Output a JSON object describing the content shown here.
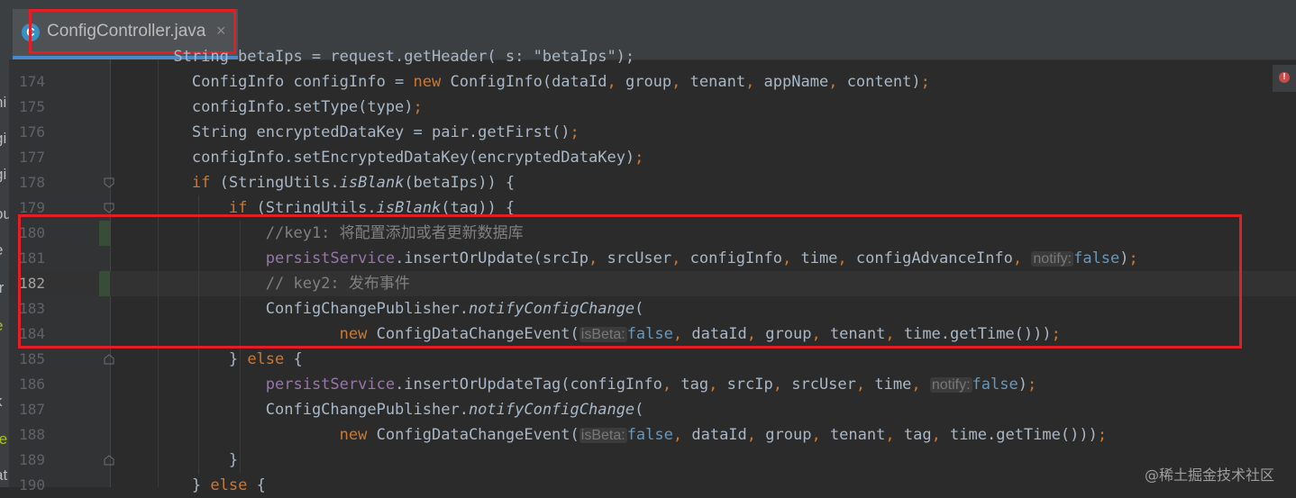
{
  "tab": {
    "title": "ConfigController.java",
    "icon": "C",
    "close": "×"
  },
  "left_fragments": [
    "hi",
    "gi",
    "gi",
    "ou",
    "e",
    "[r",
    "e",
    "[",
    "k",
    "te",
    "at"
  ],
  "line_numbers": [
    "174",
    "175",
    "176",
    "177",
    "178",
    "179",
    "180",
    "181",
    "182",
    "183",
    "184",
    "185",
    "186",
    "187",
    "188",
    "189",
    "190"
  ],
  "code": {
    "top_partial": "String betaIps = request.getHeader( s: \"betaIps\");",
    "l174": {
      "t1": "ConfigInfo configInfo = ",
      "kw": "new",
      "t2": " ConfigInfo(dataId",
      "c1": ",",
      "t3": " group",
      "c2": ",",
      "t4": " tenant",
      "c3": ",",
      "t5": " appName",
      "c4": ",",
      "t6": " content)",
      "semi": ";"
    },
    "l175": {
      "t1": "configInfo.setType(type)",
      "semi": ";"
    },
    "l176": {
      "t1": "String encryptedDataKey = pair.getFirst()",
      "semi": ";"
    },
    "l177": {
      "t1": "configInfo.setEncryptedDataKey(encryptedDataKey)",
      "semi": ";"
    },
    "l178": {
      "kw": "if",
      "t1": " (StringUtils.",
      "m": "isBlank",
      "t2": "(betaIps)) {"
    },
    "l179": {
      "kw": "if",
      "t1": " (StringUtils.",
      "m": "isBlank",
      "t2": "(tag)) {"
    },
    "l180": {
      "comment": "//key1: 将配置添加或者更新数据库"
    },
    "l181": {
      "f": "persistService",
      "t1": ".insertOrUpdate(srcIp",
      "c1": ",",
      "t2": " srcUser",
      "c2": ",",
      "t3": " configInfo",
      "c3": ",",
      "t4": " time",
      "c4": ",",
      "t5": " configAdvanceInfo",
      "c5": ",",
      "hint": "notify:",
      "val": "false",
      "t6": ")",
      "semi": ";"
    },
    "l182": {
      "comment": "// key2: 发布事件"
    },
    "l183": {
      "t1": "ConfigChangePublisher.",
      "m": "notifyConfigChange",
      "t2": "("
    },
    "l184": {
      "kw": "new",
      "t1": " ConfigDataChangeEvent(",
      "hint": "isBeta:",
      "val": "false",
      "c1": ",",
      "t2": " dataId",
      "c2": ",",
      "t3": " group",
      "c3": ",",
      "t4": " tenant",
      "c4": ",",
      "t5": " time.getTime()))",
      "semi": ";"
    },
    "l185": {
      "t1": "} ",
      "kw": "else",
      "t2": " {"
    },
    "l186": {
      "f": "persistService",
      "t1": ".insertOrUpdateTag(configInfo",
      "c1": ",",
      "t2": " tag",
      "c2": ",",
      "t3": " srcIp",
      "c3": ",",
      "t4": " srcUser",
      "c4": ",",
      "t5": " time",
      "c5": ",",
      "hint": "notify:",
      "val": "false",
      "t6": ")",
      "semi": ";"
    },
    "l187": {
      "t1": "ConfigChangePublisher.",
      "m": "notifyConfigChange",
      "t2": "("
    },
    "l188": {
      "kw": "new",
      "t1": " ConfigDataChangeEvent(",
      "hint": "isBeta:",
      "val": "false",
      "c1": ",",
      "t2": " dataId",
      "c2": ",",
      "t3": " group",
      "c3": ",",
      "t4": " tenant",
      "c4": ",",
      "t5": " tag",
      "c5": ",",
      "t6": " time.getTime()))",
      "semi": ";"
    },
    "l189": {
      "t1": "}"
    },
    "l190": {
      "t1": "} ",
      "kw": "else",
      "t2": " {"
    }
  },
  "warning": {
    "symbol": "!"
  },
  "watermark": "@稀土掘金技术社区",
  "colors": {
    "background": "#2b2b2b",
    "keyword": "#cc7832",
    "field": "#9876aa",
    "comment": "#808080",
    "number": "#6897bb",
    "highlight": "#e21e26"
  }
}
